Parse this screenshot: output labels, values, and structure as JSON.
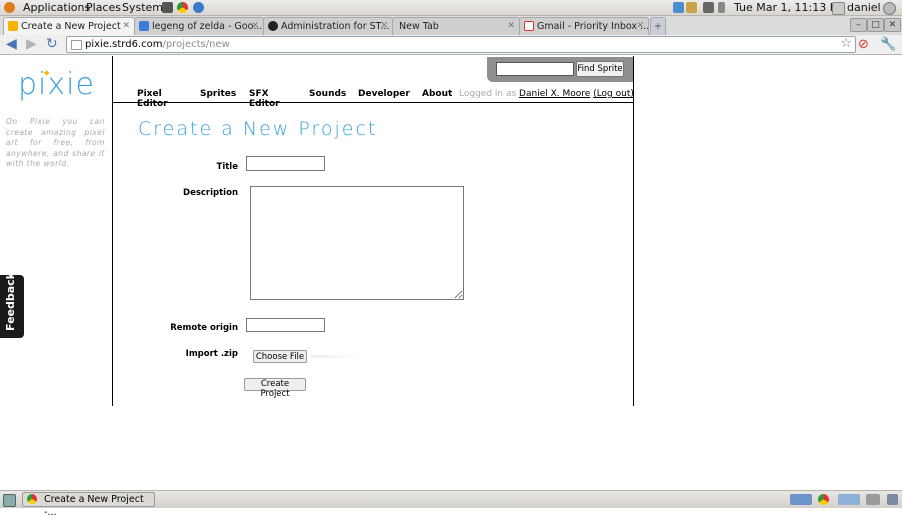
{
  "top_panel": {
    "menus": [
      "Applications",
      "Places",
      "System"
    ],
    "clock": "Tue Mar 1, 11:13 PM",
    "user": "daniel"
  },
  "tabs": [
    {
      "label": "Create a New Project",
      "active": true
    },
    {
      "label": "legeng of zelda - Goo...",
      "active": false
    },
    {
      "label": "Administration for ST...",
      "active": false
    },
    {
      "label": "New Tab",
      "active": false
    },
    {
      "label": "Gmail - Priority Inbox ...",
      "active": false
    }
  ],
  "address": {
    "host": "pixie.strd6.com",
    "path": "/projects/new"
  },
  "site": {
    "logo": "pixie",
    "tagline": "On Pixie you can create amazing pixel art for free, from anywhere, and share it with the world.",
    "nav": [
      "Pixel Editor",
      "Sprites",
      "SFX Editor",
      "Sounds",
      "Developer",
      "About"
    ],
    "logged_in_prefix": "Logged in as",
    "user_name": "Daniel X. Moore",
    "logout": "(Log out)",
    "search_button": "Find Sprite",
    "feedback": "Feedback"
  },
  "form": {
    "page_title": "Create a New Project",
    "title_label": "Title",
    "description_label": "Description",
    "remote_origin_label": "Remote origin",
    "import_label": "Import .zip",
    "choose_file": "Choose File",
    "submit": "Create Project"
  },
  "taskbar": {
    "window_title": "Create a New Project -..."
  },
  "colors": {
    "brand": "#3aa0d8",
    "logo_star": "#f4b300"
  }
}
